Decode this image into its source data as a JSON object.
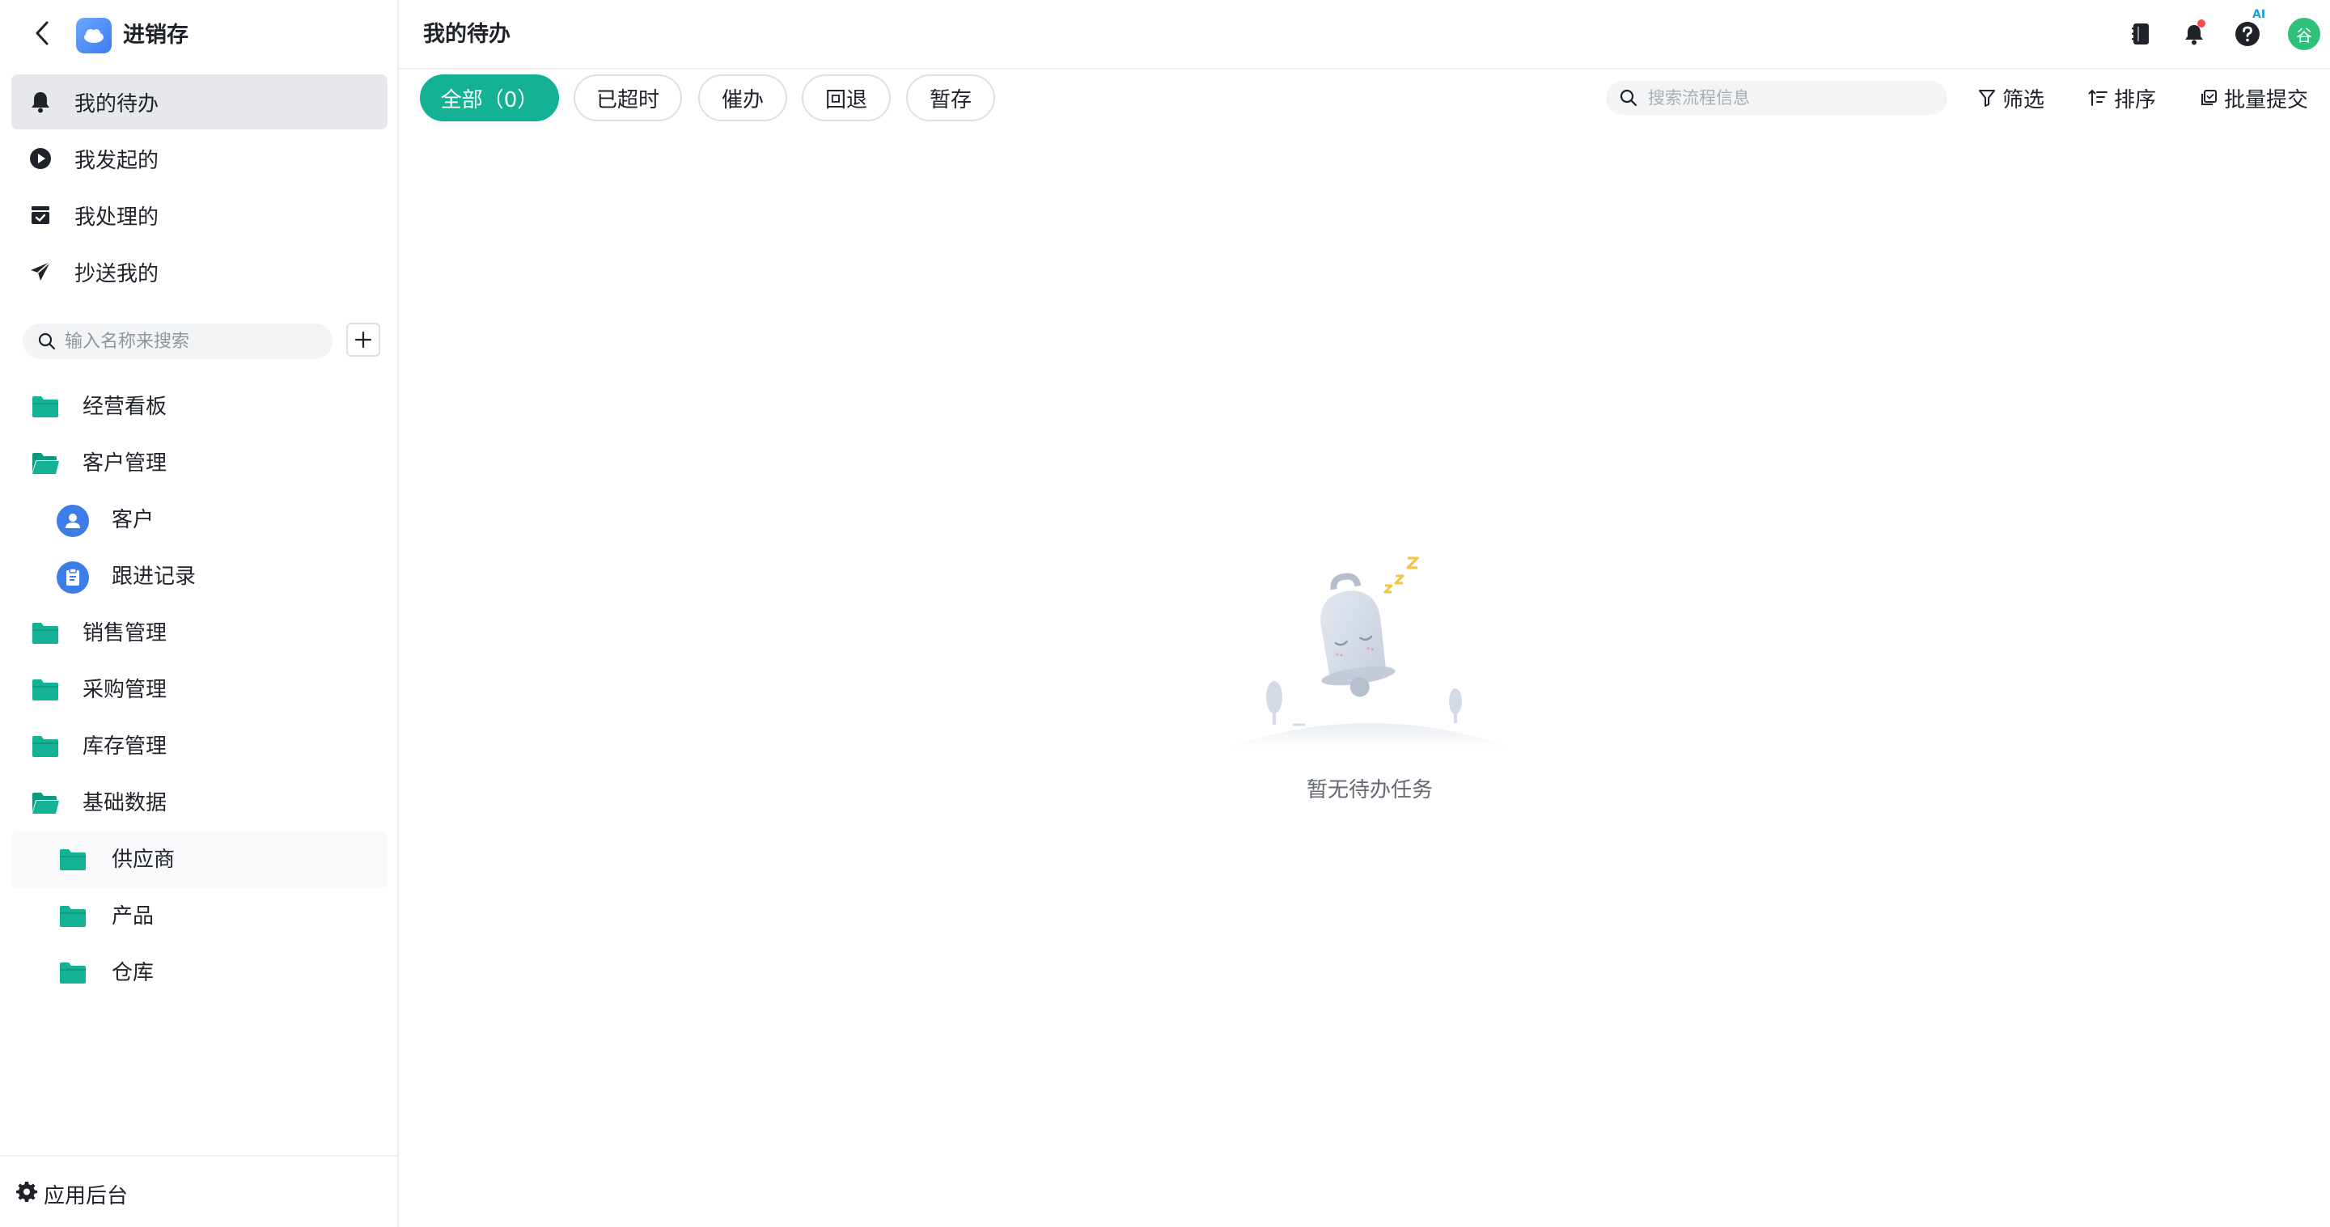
{
  "app": {
    "title": "进销存"
  },
  "sidebar": {
    "nav": [
      {
        "label": "我的待办",
        "icon": "bell-icon",
        "active": true
      },
      {
        "label": "我发起的",
        "icon": "play-circle-icon",
        "active": false
      },
      {
        "label": "我处理的",
        "icon": "inbox-check-icon",
        "active": false
      },
      {
        "label": "抄送我的",
        "icon": "paper-plane-icon",
        "active": false
      }
    ],
    "search": {
      "placeholder": "输入名称来搜索"
    },
    "tree": [
      {
        "label": "经营看板",
        "icon": "folder-icon",
        "level": 0
      },
      {
        "label": "客户管理",
        "icon": "folder-open-icon",
        "level": 0
      },
      {
        "label": "客户",
        "icon": "user-circle-icon",
        "level": 1
      },
      {
        "label": "跟进记录",
        "icon": "clipboard-circle-icon",
        "level": 1
      },
      {
        "label": "销售管理",
        "icon": "folder-icon",
        "level": 0
      },
      {
        "label": "采购管理",
        "icon": "folder-icon",
        "level": 0
      },
      {
        "label": "库存管理",
        "icon": "folder-icon",
        "level": 0
      },
      {
        "label": "基础数据",
        "icon": "folder-open-icon",
        "level": 0
      },
      {
        "label": "供应商",
        "icon": "folder-icon",
        "level": 1
      },
      {
        "label": "产品",
        "icon": "folder-icon",
        "level": 1
      },
      {
        "label": "仓库",
        "icon": "folder-icon",
        "level": 1
      }
    ],
    "footer": {
      "label": "应用后台",
      "icon": "gear-icon"
    }
  },
  "main": {
    "title": "我的待办",
    "topbar_icons": [
      "notebook-icon",
      "bell-icon",
      "help-icon",
      "avatar"
    ],
    "ai_badge": "AI",
    "avatar_text": "谷",
    "filters": [
      {
        "label": "全部（0）",
        "active": true
      },
      {
        "label": "已超时",
        "active": false
      },
      {
        "label": "催办",
        "active": false
      },
      {
        "label": "回退",
        "active": false
      },
      {
        "label": "暂存",
        "active": false
      }
    ],
    "search": {
      "placeholder": "搜索流程信息"
    },
    "tools": {
      "filter": "筛选",
      "sort": "排序",
      "batch_submit": "批量提交"
    },
    "empty_text": "暂无待办任务"
  },
  "colors": {
    "accent": "#14b294",
    "folder": "#14b294",
    "active_nav_bg": "#e6e8eb",
    "avatar": "#2fc07a",
    "circle_icon": "#3d7de8"
  }
}
